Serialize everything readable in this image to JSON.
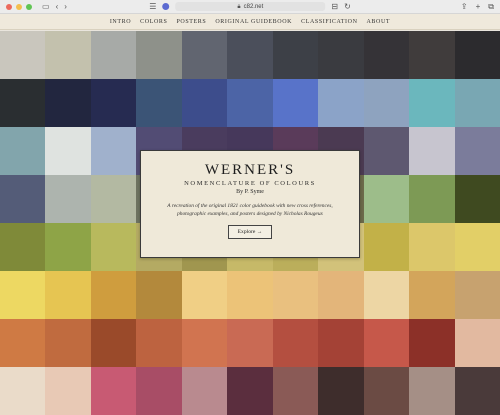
{
  "browser": {
    "url": "c82.net",
    "icons": [
      "sidebar-icon",
      "back-icon",
      "forward-icon",
      "tab-overview-icon",
      "site-favicon",
      "lock-icon",
      "reader-icon",
      "reload-icon",
      "share-icon",
      "new-tab-icon",
      "tabs-icon"
    ]
  },
  "nav": {
    "items": [
      {
        "label": "INTRO"
      },
      {
        "label": "COLORS"
      },
      {
        "label": "POSTERS"
      },
      {
        "label": "ORIGINAL GUIDEBOOK"
      },
      {
        "label": "CLASSIFICATION"
      },
      {
        "label": "ABOUT"
      }
    ]
  },
  "card": {
    "title": "WERNER'S",
    "subtitle": "NOMENCLATURE OF COLOURS",
    "byline": "By P. Syme",
    "description": "A recreation of the original 1821 color guidebook with new cross references, photographic examples, and posters designed by Nicholas Rougeux",
    "button": "Explore →"
  },
  "colors": {
    "swatches": [
      "#c9c6bd",
      "#c3c1ad",
      "#a7aaa7",
      "#8e918a",
      "#616570",
      "#4b4f5b",
      "#3d4047",
      "#3a3b40",
      "#353337",
      "#403c3c",
      "#2c2b2e",
      "#2a2e31",
      "#22263f",
      "#262b51",
      "#3b5476",
      "#3d4d8c",
      "#4c64a6",
      "#5873c9",
      "#8ba3c8",
      "#8ea3bf",
      "#6bb7bd",
      "#79a7b3",
      "#82a5ac",
      "#dfe3e0",
      "#a0b1cc",
      "#524c74",
      "#4a3c5e",
      "#46385b",
      "#5a3b5a",
      "#4b3a52",
      "#5e5870",
      "#c7c5cf",
      "#7b7c9b",
      "#545c78",
      "#adb4ae",
      "#b3b9a2",
      "#6e7360",
      "#6c6e5c",
      "#8c8a71",
      "#a49c7b",
      "#6c6a4a",
      "#9dbd8a",
      "#7d9a55",
      "#3f4a20",
      "#7f8a39",
      "#8ea447",
      "#b8b95d",
      "#b4aa63",
      "#a0964f",
      "#c6b968",
      "#bbae5b",
      "#d2c27a",
      "#c2b148",
      "#dcc76a",
      "#e2cf67",
      "#edd862",
      "#e6c552",
      "#cf9d3e",
      "#b3893c",
      "#f0cf85",
      "#ecc378",
      "#e9c07f",
      "#e3b57a",
      "#edd6a4",
      "#d3a55b",
      "#c7a26f",
      "#cf7a44",
      "#c06b3f",
      "#9a4a2a",
      "#bd6340",
      "#d17450",
      "#c96a54",
      "#b44f40",
      "#a44236",
      "#c6584a",
      "#8c3028",
      "#e2b9a0",
      "#eadbc9",
      "#e8c9b5",
      "#c85a73",
      "#a84d66",
      "#b98a8f",
      "#5b2e3e",
      "#8a5a56",
      "#3e2d2c",
      "#6b4b44",
      "#a58f86",
      "#4a3a3a"
    ]
  }
}
